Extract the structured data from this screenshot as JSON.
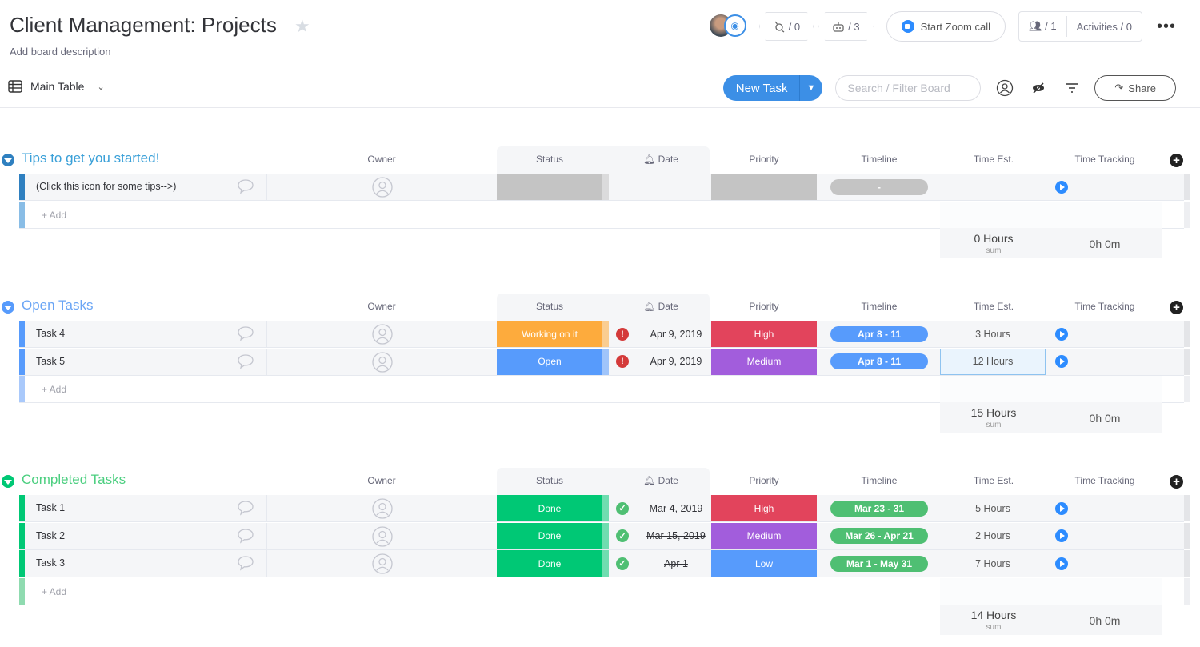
{
  "header": {
    "title": "Client Management: Projects",
    "description": "Add board description",
    "view_label": "Main Table",
    "integrations_count": "/ 0",
    "automations_count": "/ 3",
    "zoom_label": "Start Zoom call",
    "members_count": "/ 1",
    "activities_label": "Activities / 0",
    "more_label": "•••"
  },
  "toolbar": {
    "new_task_label": "New Task",
    "search_placeholder": "Search / Filter Board",
    "share_label": "Share"
  },
  "columns": {
    "owner": "Owner",
    "status": "Status",
    "date": "Date",
    "priority": "Priority",
    "timeline": "Timeline",
    "time_est": "Time Est.",
    "time_tracking": "Time Tracking"
  },
  "colors": {
    "tips": "#2f80c0",
    "open": "#579bfc",
    "completed": "#00c875",
    "status_working": "#fdab3d",
    "status_open": "#579bfc",
    "status_done": "#00c875",
    "priority_high": "#e2445c",
    "priority_medium": "#a25ddc",
    "priority_low": "#579bfc",
    "empty": "#c4c4c4"
  },
  "add_label": "+ Add",
  "groups": [
    {
      "title": "Tips to get you started!",
      "sum_est": "0 Hours",
      "sum_label": "sum",
      "sum_track": "0h 0m",
      "rows": [
        {
          "name": "(Click this icon for some tips-->)",
          "status": "",
          "date": "",
          "priority": "",
          "timeline": "-",
          "time_est": ""
        }
      ]
    },
    {
      "title": "Open Tasks",
      "sum_est": "15 Hours",
      "sum_label": "sum",
      "sum_track": "0h 0m",
      "rows": [
        {
          "name": "Task 4",
          "status": "Working on it",
          "date": "Apr 9, 2019",
          "priority": "High",
          "timeline": "Apr 8 - 11",
          "time_est": "3 Hours"
        },
        {
          "name": "Task 5",
          "status": "Open",
          "date": "Apr 9, 2019",
          "priority": "Medium",
          "timeline": "Apr 8 - 11",
          "time_est": "12 Hours"
        }
      ]
    },
    {
      "title": "Completed Tasks",
      "sum_est": "14 Hours",
      "sum_label": "sum",
      "sum_track": "0h 0m",
      "rows": [
        {
          "name": "Task 1",
          "status": "Done",
          "date": "Mar 4, 2019",
          "priority": "High",
          "timeline": "Mar 23 - 31",
          "time_est": "5 Hours"
        },
        {
          "name": "Task 2",
          "status": "Done",
          "date": "Mar 15, 2019",
          "priority": "Medium",
          "timeline": "Mar 26 - Apr 21",
          "time_est": "2 Hours"
        },
        {
          "name": "Task 3",
          "status": "Done",
          "date": "Apr 1",
          "priority": "Low",
          "timeline": "Mar 1 - May 31",
          "time_est": "7 Hours"
        }
      ]
    }
  ]
}
